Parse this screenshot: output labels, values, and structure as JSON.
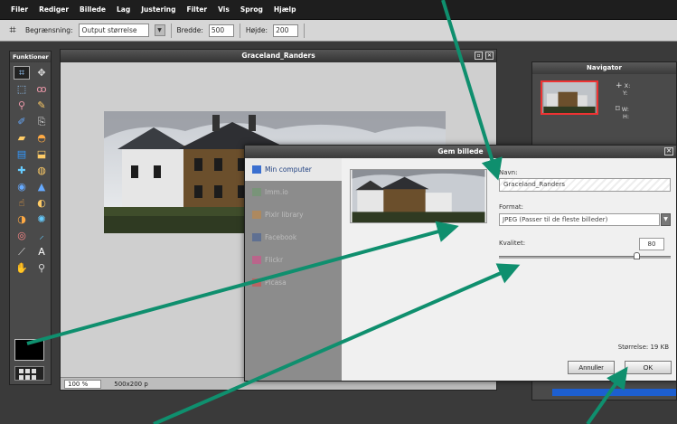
{
  "menu": [
    "Filer",
    "Rediger",
    "Billede",
    "Lag",
    "Justering",
    "Filter",
    "Vis",
    "Sprog",
    "Hjælp"
  ],
  "options": {
    "tool_icon": "crop-icon",
    "limit_label": "Begrænsning:",
    "limit_value": "Output størrelse",
    "width_label": "Bredde:",
    "width_value": "500",
    "height_label": "Højde:",
    "height_value": "200"
  },
  "tools_panel": {
    "title": "Funktioner",
    "tools": [
      "crop-icon",
      "move-icon",
      "marquee-icon",
      "lasso-icon",
      "wand-icon",
      "pencil-icon",
      "brush-icon",
      "clone-icon",
      "eraser-icon",
      "bucket-icon",
      "gradient-icon",
      "stamp-icon",
      "heal-icon",
      "sponge-icon",
      "blur-icon",
      "sharpen-icon",
      "smudge-icon",
      "dodge-icon",
      "burn-icon",
      "pinch-icon",
      "redeye-icon",
      "eyedropper-icon",
      "picker-icon",
      "text-icon",
      "hand-icon",
      "zoom-icon"
    ]
  },
  "image_window": {
    "title": "Graceland_Randers",
    "zoom": "100",
    "zoom_unit": "%",
    "dimensions": "500x200 p"
  },
  "navigator": {
    "title": "Navigator",
    "x_label": "X:",
    "y_label": "Y:",
    "w_label": "W:",
    "h_label": "H:"
  },
  "dialog": {
    "title": "Gem billede",
    "sources": [
      {
        "label": "Min computer",
        "icon": "computer-icon",
        "color": "#3a6fd0"
      },
      {
        "label": "Imm.io",
        "icon": "image-icon",
        "color": "#6a9a6a"
      },
      {
        "label": "Pixlr library",
        "icon": "library-icon",
        "color": "#c9863a"
      },
      {
        "label": "Facebook",
        "icon": "facebook-icon",
        "color": "#3b5998"
      },
      {
        "label": "Flickr",
        "icon": "flickr-icon",
        "color": "#e0468a"
      },
      {
        "label": "Picasa",
        "icon": "picasa-icon",
        "color": "#d44"
      }
    ],
    "name_label": "Navn:",
    "name_value": "Graceland_Randers",
    "format_label": "Format:",
    "format_value": "JPEG (Passer til de fleste billeder)",
    "quality_label": "Kvalitet:",
    "quality_value": "80",
    "quality_fraction": 0.8,
    "size_text": "Størrelse: 19 KB",
    "cancel_label": "Annuller",
    "ok_label": "OK"
  },
  "colors": {
    "annotation_arrow": "#0f8f6e",
    "accent": "#1d5fd0"
  }
}
